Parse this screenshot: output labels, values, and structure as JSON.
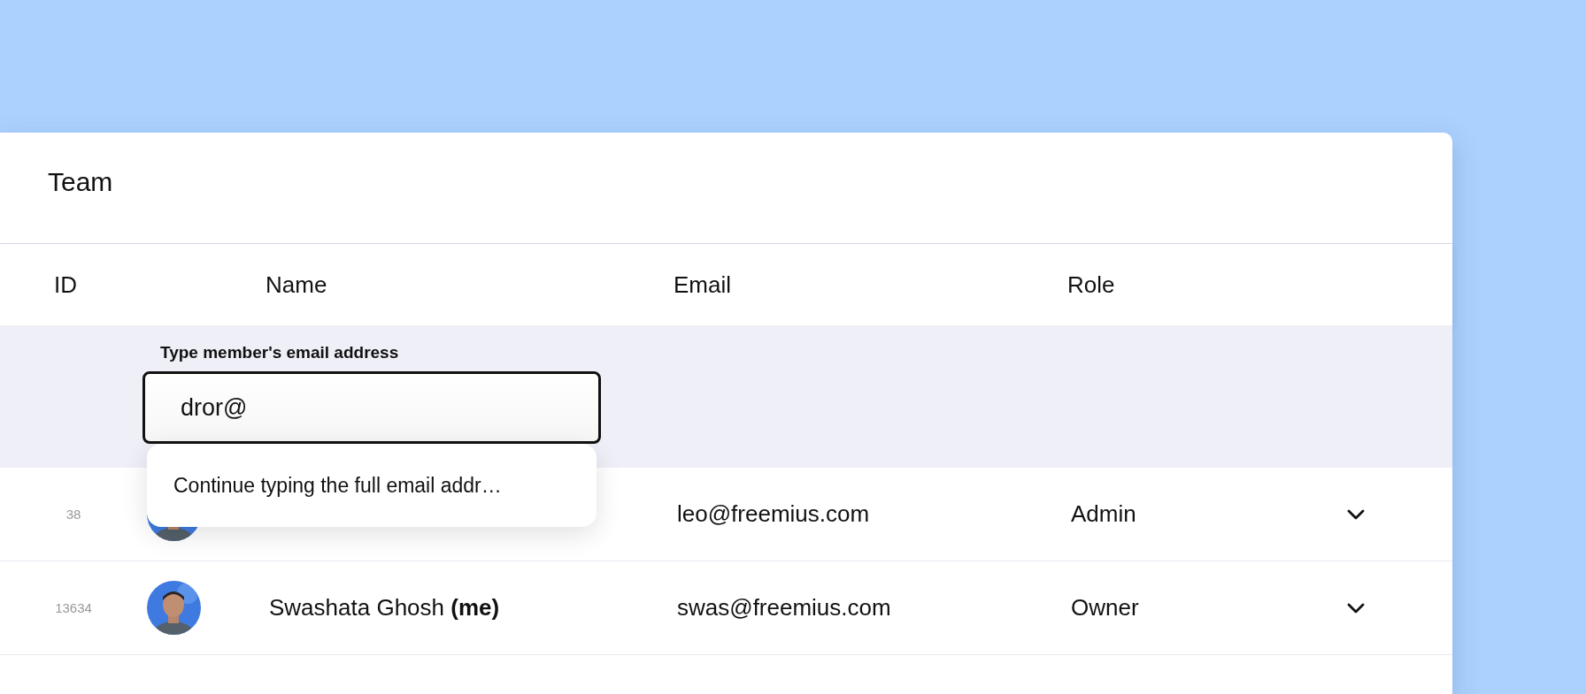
{
  "card": {
    "title": "Team"
  },
  "table": {
    "columns": [
      "ID",
      "Name",
      "Email",
      "Role"
    ],
    "add_member": {
      "label": "Type member's email address",
      "value": "dror@",
      "suggestion": "Continue typing the full email addr…"
    },
    "rows": [
      {
        "id": "38",
        "email": "leo@freemius.com",
        "role": "Admin"
      },
      {
        "id": "13634",
        "name": "Swashata Ghosh **(me)**",
        "email": "swas@freemius.com",
        "role": "Owner"
      }
    ]
  }
}
